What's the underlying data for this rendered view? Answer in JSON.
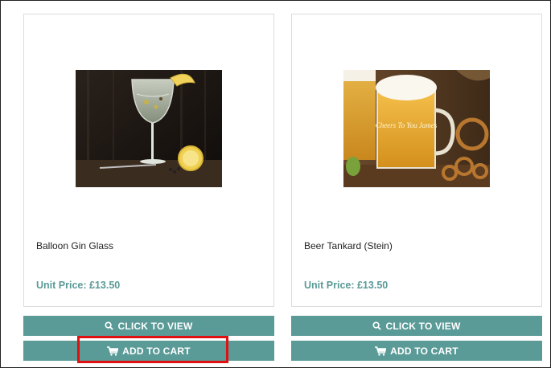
{
  "products": [
    {
      "name": "Balloon Gin Glass",
      "unit_price": "Unit Price: £13.50",
      "view_label": "CLICK TO VIEW",
      "cart_label": "ADD TO CART"
    },
    {
      "name": "Beer Tankard (Stein)",
      "unit_price": "Unit Price: £13.50",
      "view_label": "CLICK TO VIEW",
      "cart_label": "ADD TO CART",
      "engraving": "Cheers To You James"
    }
  ],
  "icons": {
    "view": "search-icon",
    "cart": "cart-icon"
  },
  "colors": {
    "accent": "#5a9a97",
    "highlight": "#e01010"
  }
}
